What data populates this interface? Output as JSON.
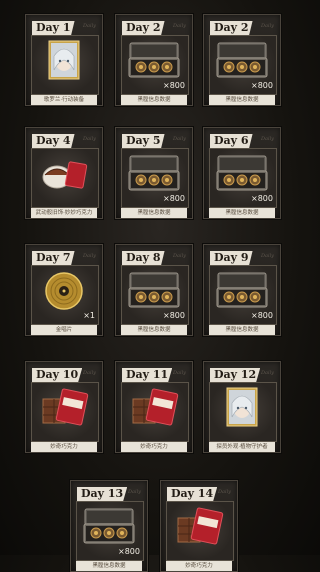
{
  "rewards": [
    {
      "day": "Day 1",
      "watermark": "Daily",
      "icon": "character-portrait-icon",
      "qty": "",
      "label": "歌罗兰·行动装备"
    },
    {
      "day": "Day 2",
      "watermark": "Daily",
      "icon": "data-case-icon",
      "qty": "×800",
      "label": "黑膛信息数据"
    },
    {
      "day": "Day 2",
      "watermark": "Daily",
      "icon": "data-case-icon",
      "qty": "×800",
      "label": "黑膛信息数据"
    },
    {
      "day": "Day 4",
      "watermark": "Daily",
      "icon": "pastry-icon",
      "qty": "",
      "label": "武动般旧饰·妙妙巧克力"
    },
    {
      "day": "Day 5",
      "watermark": "Daily",
      "icon": "data-case-icon",
      "qty": "×800",
      "label": "黑膛信息数据"
    },
    {
      "day": "Day 6",
      "watermark": "Daily",
      "icon": "data-case-icon",
      "qty": "×800",
      "label": "黑膛信息数据"
    },
    {
      "day": "Day 7",
      "watermark": "Daily",
      "icon": "gold-record-icon",
      "qty": "×1",
      "label": "金唱片"
    },
    {
      "day": "Day 8",
      "watermark": "Daily",
      "icon": "data-case-icon",
      "qty": "×800",
      "label": "黑膛信息数据"
    },
    {
      "day": "Day 9",
      "watermark": "Daily",
      "icon": "data-case-icon",
      "qty": "×800",
      "label": "黑膛信息数据"
    },
    {
      "day": "Day 10",
      "watermark": "Daily",
      "icon": "chocolate-icon",
      "qty": "",
      "label": "妙奇巧克力"
    },
    {
      "day": "Day 11",
      "watermark": "Daily",
      "icon": "chocolate-icon",
      "qty": "",
      "label": "妙奇巧克力"
    },
    {
      "day": "Day 12",
      "watermark": "Daily",
      "icon": "character-portrait-icon",
      "qty": "",
      "label": "探员外观·植物守护者"
    },
    {
      "day": "Day 13",
      "watermark": "Daily",
      "icon": "data-case-icon",
      "qty": "×800",
      "label": "黑膛信息数据"
    },
    {
      "day": "Day 14",
      "watermark": "Daily",
      "icon": "chocolate-icon",
      "qty": "",
      "label": "妙奇巧克力"
    }
  ],
  "colors": {
    "card_bg": "#2c2925",
    "label_bg": "#e8e3d8",
    "day_tag_bg": "#e7e1d5",
    "gold": "#c9a33a"
  }
}
